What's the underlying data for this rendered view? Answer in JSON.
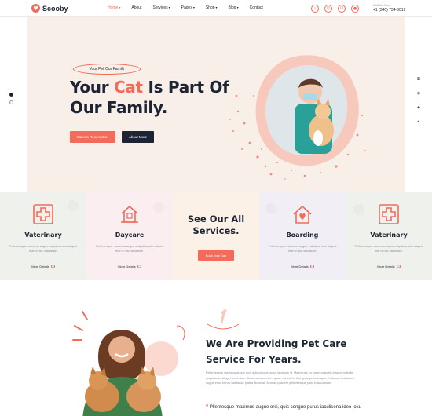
{
  "brand": {
    "name": "Scooby",
    "accent": "#f26b5b",
    "dark": "#1d2433"
  },
  "nav": {
    "items": [
      {
        "label": "Home",
        "active": true,
        "has_caret": true
      },
      {
        "label": "About",
        "active": false,
        "has_caret": false
      },
      {
        "label": "Services",
        "active": false,
        "has_caret": true
      },
      {
        "label": "Pages",
        "active": false,
        "has_caret": true
      },
      {
        "label": "Shop",
        "active": false,
        "has_caret": true
      },
      {
        "label": "Blog",
        "active": false,
        "has_caret": true
      },
      {
        "label": "Contact",
        "active": false,
        "has_caret": false
      }
    ],
    "icons": [
      "search-icon",
      "user-icon",
      "cart-icon",
      "account-icon"
    ]
  },
  "call": {
    "label": "Call Us Now",
    "number": "+1 (340) 734-3019"
  },
  "hero": {
    "badge": "Your Pet Our Family",
    "title_before": "Your ",
    "title_accent": "Cat",
    "title_after": " Is Part Of",
    "title_line2": "Our Family.",
    "primary_button": "Make a Reservation",
    "secondary_button": "About More"
  },
  "services": {
    "items": [
      {
        "name": "Vaterinary",
        "desc": "Pellentesque maximus augue ecilpalica ulim aliquet man in fac habitasse.",
        "more": "More Details",
        "icon": "medical-cross-icon",
        "bg": "#eef1ec"
      },
      {
        "name": "Daycare",
        "desc": "Pellentesque maximus augue ecilpalica ulim aliquet man in fac habitasse.",
        "more": "More Details",
        "icon": "pet-house-icon",
        "bg": "#fbeef0"
      },
      {
        "name": "Boarding",
        "desc": "Pellentesque maximus augue ecilpalica ulim aliquet man in fac habitasse.",
        "more": "More Details",
        "icon": "heart-house-icon",
        "bg": "#f2eef6"
      },
      {
        "name": "Vaterinary",
        "desc": "Pellentesque maximus augue ecilpalica ulim aliquet man in fac habitasse.",
        "more": "More Details",
        "icon": "medical-cross-icon",
        "bg": "#eef1ec"
      }
    ],
    "center_title_line1": "See Our All",
    "center_title_line2": "Services.",
    "center_button": "Book Your Day",
    "center_bg": "#fbf1e7"
  },
  "about": {
    "title_line1": "We Are Providing Pet Care",
    "title_line2": "Service For Years.",
    "paragraph": "Pellentesque maximus augue orci, quis congue purus iaculison id. Maecenas eu lorem quisvelit massa molestie vulputate in sitaget amet diam. Cras eu elementum quam cursus for that gone pellentesque, thuisnus Vestibulum augue eros. In hac habitasse platea dictumst. Aenean posuere pellentesque justo in accumsan.",
    "quote": "Pllentesque maximus augue orci, quis congue purus iaculisena ideo joku"
  }
}
